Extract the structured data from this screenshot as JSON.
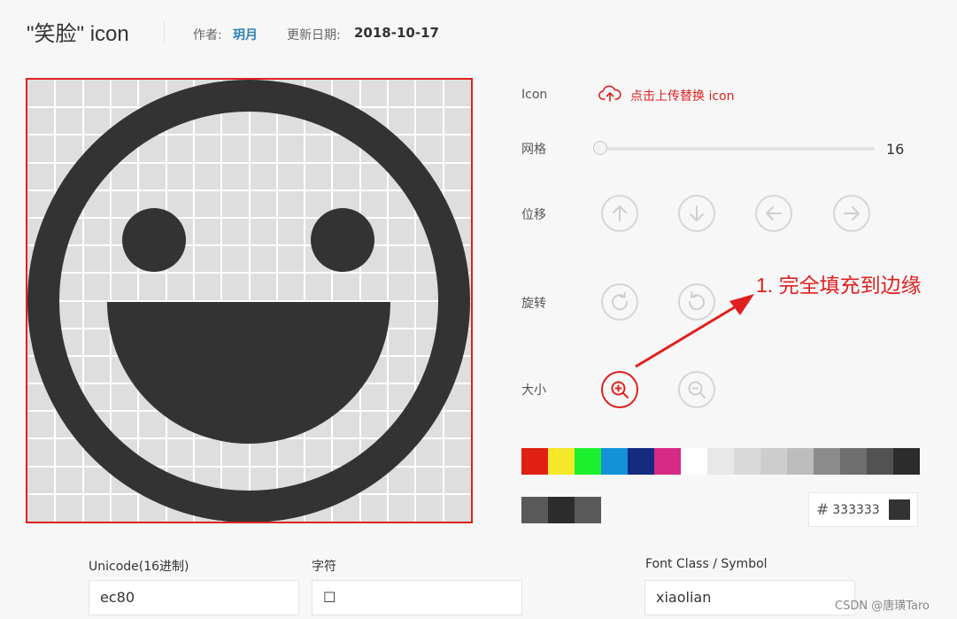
{
  "header": {
    "title": "\"笑脸\" icon",
    "author_label": "作者:",
    "author": "玥月",
    "date_label": "更新日期:",
    "date": "2018-10-17"
  },
  "controls": {
    "icon_label": "Icon",
    "upload_label": "点击上传替换 icon",
    "grid_label": "网格",
    "grid_value": "16",
    "move_label": "位移",
    "rotate_label": "旋转",
    "size_label": "大小"
  },
  "colors": {
    "accent": "#e02020",
    "icon_color": "#333333",
    "palette": [
      "#e02010",
      "#f5e72a",
      "#1df02f",
      "#1392d9",
      "#152b80",
      "#d62a85",
      "#ffffff",
      "#e8e8e8",
      "#d9d9d9",
      "#cdcdcd",
      "#bdbdbd",
      "#8c8c8c",
      "#6f6f6f",
      "#525252",
      "#2c2c2c"
    ],
    "palette_row2": [
      "#595959",
      "#2c2c2c",
      "#595959"
    ]
  },
  "hex_input": {
    "hash": "#",
    "value": "333333"
  },
  "fields": {
    "unicode_label": "Unicode(16进制)",
    "unicode_value": "ec80",
    "char_label": "字符",
    "char_value": "☐",
    "font_label": "Font Class / Symbol",
    "font_value": "xiaolian"
  },
  "annotation": "1. 完全填充到边缘",
  "watermark": "CSDN @唐璜Taro",
  "icons": {
    "upload": "cloud-upload-icon",
    "up": "arrow-up-icon",
    "down": "arrow-down-icon",
    "left": "arrow-left-icon",
    "right": "arrow-right-icon",
    "rotate_cw": "rotate-clockwise-icon",
    "rotate_ccw": "rotate-counterclockwise-icon",
    "zoom_in": "zoom-in-icon",
    "zoom_out": "zoom-out-icon"
  }
}
